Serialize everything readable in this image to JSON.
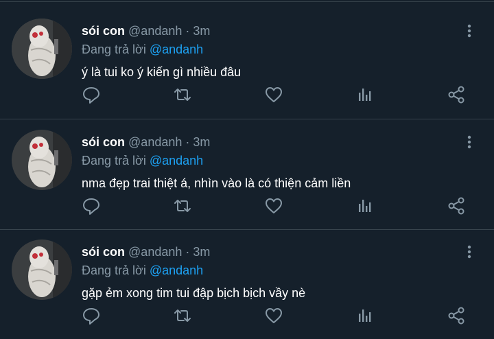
{
  "tweets": [
    {
      "name": "sói con",
      "handle": "@andanh",
      "separator": "·",
      "time": "3m",
      "reply_prefix": "Đang trả lời",
      "reply_to": "@andanh",
      "text": "ý là tui ko ý kiến gì nhiều đâu"
    },
    {
      "name": "sói con",
      "handle": "@andanh",
      "separator": "·",
      "time": "3m",
      "reply_prefix": "Đang trả lời",
      "reply_to": "@andanh",
      "text": "nma đẹp trai thiệt á, nhìn vào là có thiện cảm liền"
    },
    {
      "name": "sói con",
      "handle": "@andanh",
      "separator": "·",
      "time": "3m",
      "reply_prefix": "Đang trả lời",
      "reply_to": "@andanh",
      "text": "gặp ẻm xong tim tui đập bịch bịch vầy nè"
    }
  ],
  "icons": [
    "more-icon",
    "reply-icon",
    "retweet-icon",
    "like-icon",
    "analytics-icon",
    "share-icon"
  ],
  "colors": {
    "background": "#15202b",
    "divider": "#38444d",
    "secondary_text": "#8899a6",
    "mention": "#1da1f2",
    "icon": "#8899a6"
  }
}
